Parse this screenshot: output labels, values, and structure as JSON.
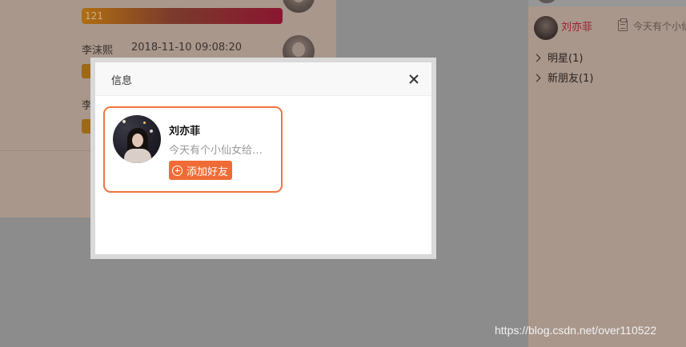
{
  "background": {
    "progress_value": "121",
    "messages": [
      {
        "name": "李沫熙",
        "time": "2018-11-10 09:08:20"
      },
      {
        "name": "李"
      }
    ]
  },
  "sidebar": {
    "user": {
      "name": "刘亦菲",
      "signature": "今天有个小仙"
    },
    "groups": [
      {
        "label": "明星(1)"
      },
      {
        "label": "新朋友(1)"
      }
    ]
  },
  "modal": {
    "title": "信息",
    "card": {
      "name": "刘亦菲",
      "signature": "今天有个小仙女给我送了个礼物",
      "add_label": "添加好友"
    }
  },
  "watermark": "https://blog.csdn.net/over110522",
  "colors": {
    "accent": "#f06b35",
    "card_border": "#f07541",
    "overlay": "#8c8c8c"
  }
}
